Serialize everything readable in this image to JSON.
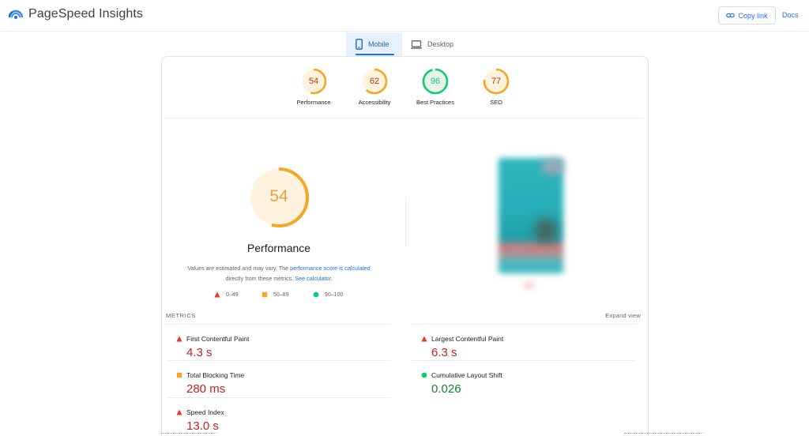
{
  "header": {
    "app_name": "PageSpeed Insights",
    "copy_link_label": "Copy link",
    "docs_label": "Docs",
    "logo_icon": "pagespeed-logo-icon",
    "link_icon": "link-icon"
  },
  "tabs": [
    {
      "label": "Mobile",
      "icon": "smartphone-icon",
      "selected": true
    },
    {
      "label": "Desktop",
      "icon": "desktop-icon",
      "selected": false
    }
  ],
  "categories": [
    {
      "label": "Performance",
      "score": "54",
      "level": "average",
      "fraction": 0.54
    },
    {
      "label": "Accessibility",
      "score": "62",
      "level": "average",
      "fraction": 0.62
    },
    {
      "label": "Best Practices",
      "score": "96",
      "level": "pass",
      "fraction": 0.96
    },
    {
      "label": "SEO",
      "score": "77",
      "level": "average",
      "fraction": 0.77
    }
  ],
  "performance": {
    "score": "54",
    "fraction": 0.54,
    "title": "Performance",
    "description_1": "Values are estimated and may vary. The ",
    "link_1": "performance score is calculated",
    "description_2": " directly from these metrics. ",
    "link_2": "See calculator.",
    "legend": [
      {
        "range": "0–49",
        "shape": "triangle",
        "color": "#e53935"
      },
      {
        "range": "50–89",
        "shape": "square",
        "color": "#f5a623"
      },
      {
        "range": "90–100",
        "shape": "circle",
        "color": "#0cce6b"
      }
    ]
  },
  "metrics": {
    "header": "METRICS",
    "expand_label": "Expand view",
    "items": [
      {
        "label": "First Contentful Paint",
        "value": "4.3 s",
        "level": "fail"
      },
      {
        "label": "Largest Contentful Paint",
        "value": "6.3 s",
        "level": "fail"
      },
      {
        "label": "Total Blocking Time",
        "value": "280 ms",
        "level": "average"
      },
      {
        "label": "Cumulative Layout Shift",
        "value": "0.026",
        "level": "pass"
      },
      {
        "label": "Speed Index",
        "value": "13.0 s",
        "level": "fail"
      }
    ]
  },
  "colors": {
    "fail": "#e53935",
    "average": "#f5a623",
    "pass": "#0cce6b",
    "average_text": "#c33300",
    "average_bg": "#fff3e0",
    "pass_bg": "#e6f4ea",
    "accent": "#1a73e8"
  }
}
